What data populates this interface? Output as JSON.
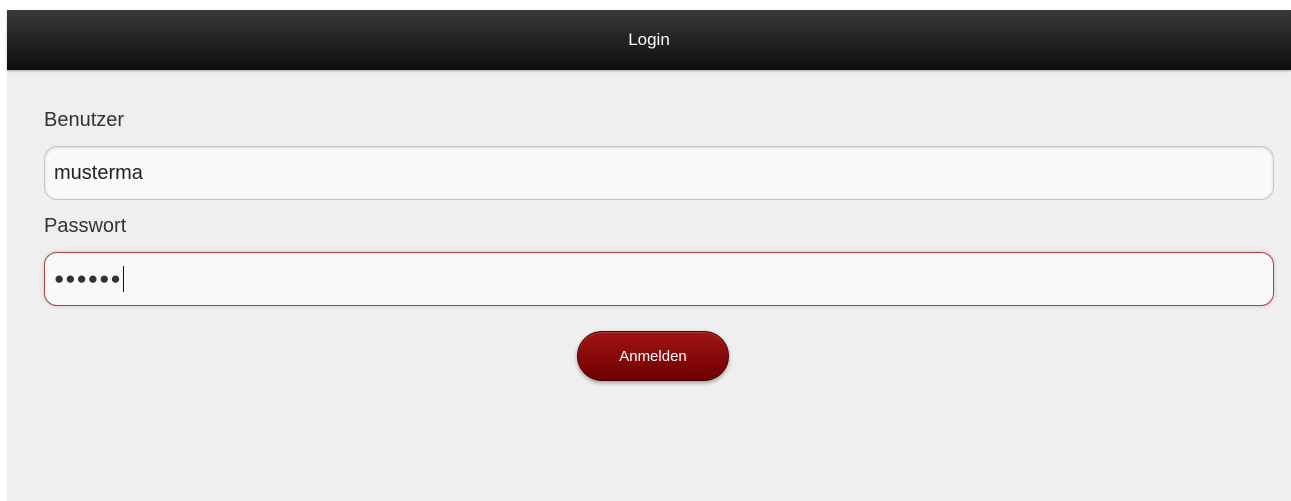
{
  "header": {
    "title": "Login"
  },
  "form": {
    "user_label": "Benutzer",
    "user_value": "musterma",
    "password_label": "Passwort",
    "password_value": "●●●●●●",
    "submit_label": "Anmelden"
  },
  "colors": {
    "header_bg": "#1a1a1a",
    "page_bg": "#efefef",
    "accent": "#8b0000",
    "focus_border": "#a64444"
  }
}
